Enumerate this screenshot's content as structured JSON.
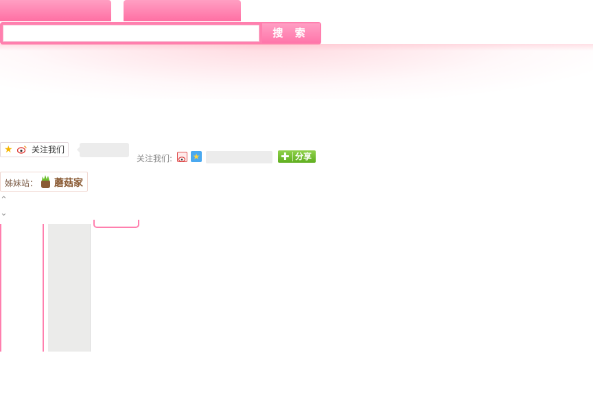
{
  "search": {
    "button_label": "搜 索",
    "input_value": ""
  },
  "follow": {
    "box_label": "关注我们",
    "inline_label": "关注我们:",
    "share_label": "分享",
    "share_plus": "✚",
    "qzone_glyph": "★"
  },
  "sister_site": {
    "label": "姊妹站：",
    "name": "蘑菇家"
  },
  "nav_arrows": {
    "up": "⌃",
    "down": "⌄"
  },
  "colors": {
    "accent_pink": "#ff7fae",
    "share_green": "#6cbf2a"
  },
  "icons": [
    "star-icon",
    "weibo-icon",
    "sina-weibo-icon",
    "qzone-icon",
    "mushroom-icon",
    "chevron-up-icon",
    "chevron-down-icon"
  ]
}
